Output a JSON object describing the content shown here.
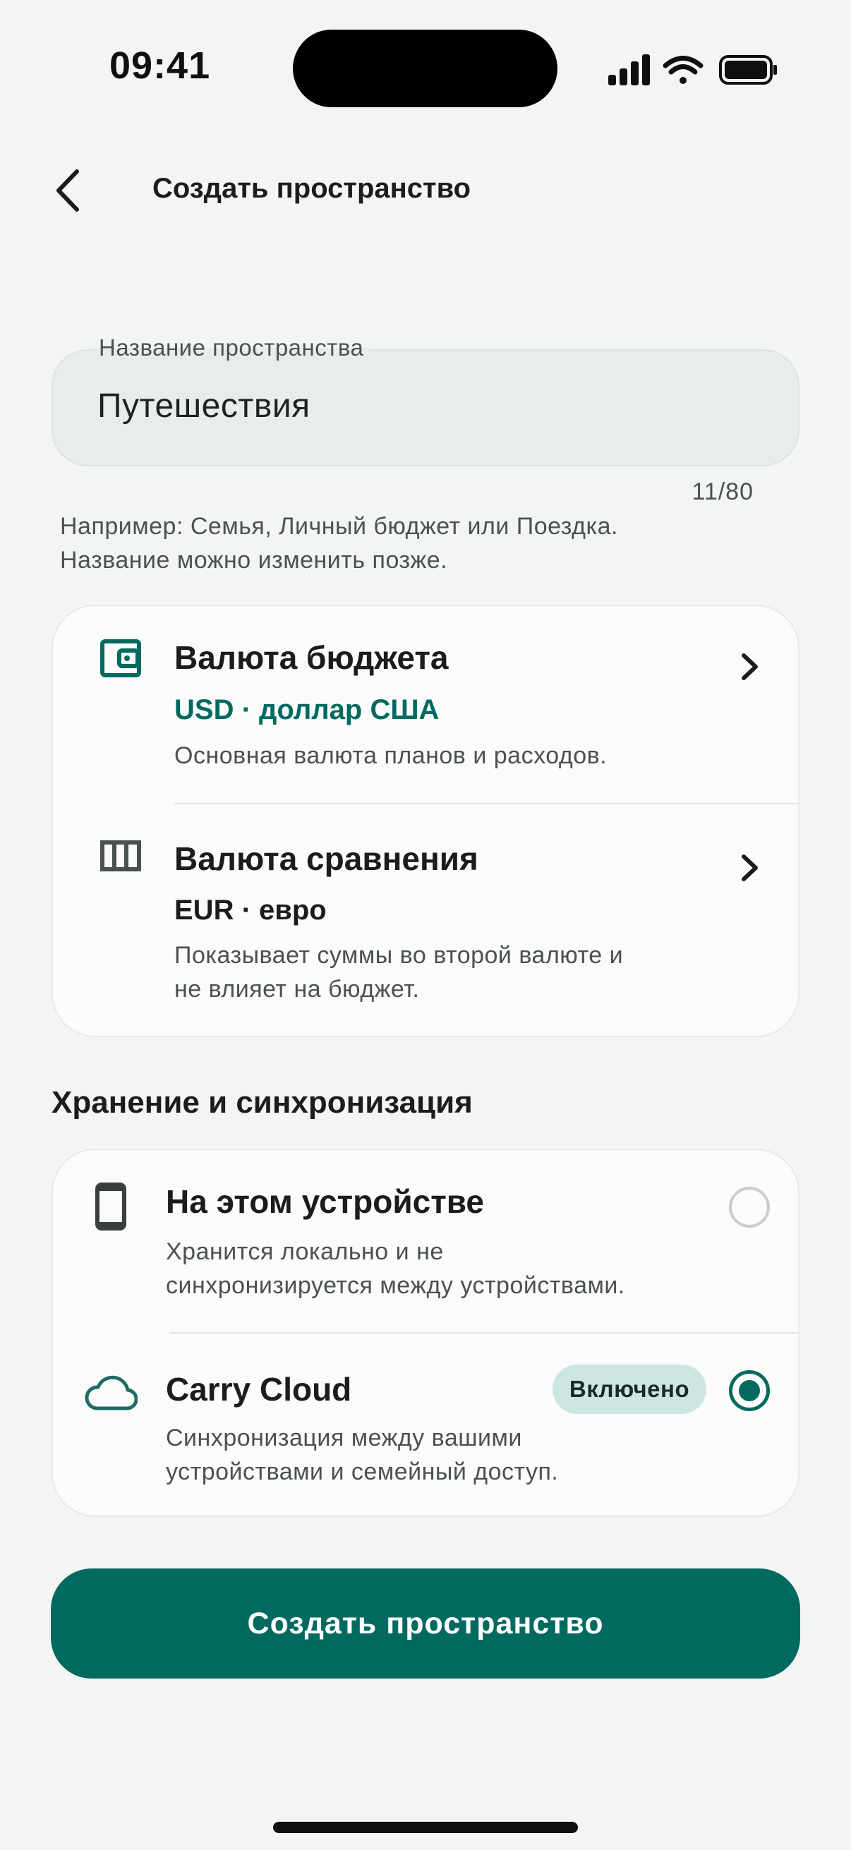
{
  "status_bar": {
    "time": "09:41"
  },
  "header": {
    "title": "Создать пространство",
    "back_icon": "chevron-left-icon"
  },
  "name_field": {
    "label": "Название пространства",
    "value": "Путешествия",
    "counter": "11/80"
  },
  "hint": {
    "line1": "Например: Семья, Личный бюджет или Поездка.",
    "line2": "Название можно изменить позже."
  },
  "currency": {
    "budget": {
      "icon": "wallet-icon",
      "title": "Валюта бюджета",
      "value": "USD · доллар США",
      "description": "Основная валюта планов и расходов."
    },
    "comparison": {
      "icon": "columns-icon",
      "title": "Валюта сравнения",
      "value": "EUR · евро",
      "description_line1": "Показывает суммы во второй валюте и",
      "description_line2": "не влияет на бюджет."
    }
  },
  "storage": {
    "section_title": "Хранение и синхронизация",
    "local": {
      "icon": "phone-icon",
      "title": "На этом устройстве",
      "description_line1": "Хранится локально и не",
      "description_line2": "синхронизируется между устройствами.",
      "selected": false
    },
    "cloud": {
      "icon": "cloud-icon",
      "title": "Carry Cloud",
      "badge": "Включено",
      "description_line1": "Синхронизация между вашими",
      "description_line2": "устройствами и семейный доступ.",
      "selected": true
    }
  },
  "primary_button": {
    "label": "Создать пространство"
  },
  "colors": {
    "background": "#F3F5F3",
    "accent": "#006A60",
    "badge_bg": "#CCE7E1",
    "card_bg": "#FAFBFA"
  }
}
